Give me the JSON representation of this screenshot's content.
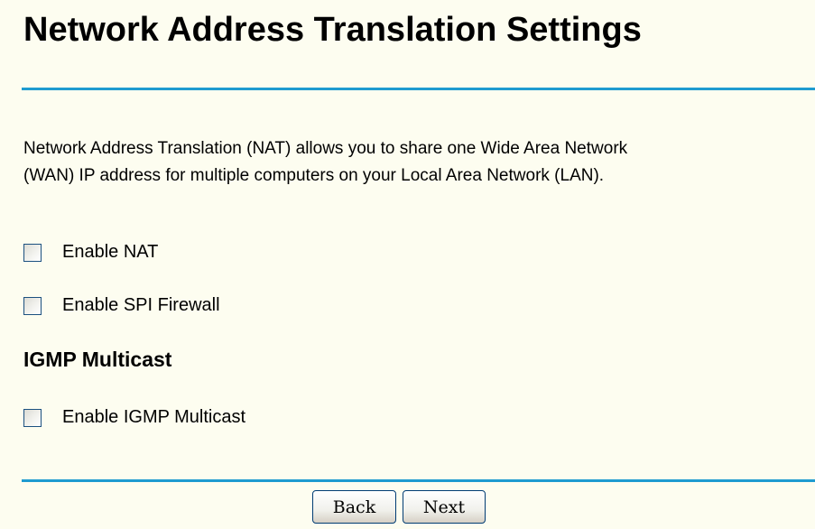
{
  "page": {
    "title": "Network Address Translation Settings",
    "description_line1": "Network Address Translation (NAT) allows you to share one Wide Area Network",
    "description_line2": "(WAN) IP address for multiple computers on your Local Area Network (LAN)."
  },
  "nat_options": [
    {
      "label": "Enable NAT",
      "checked": false
    },
    {
      "label": "Enable SPI Firewall",
      "checked": false
    }
  ],
  "igmp_section": {
    "heading": "IGMP Multicast",
    "option": {
      "label": "Enable IGMP Multicast",
      "checked": false
    }
  },
  "buttons": {
    "back_label": "Back",
    "next_label": "Next"
  },
  "colors": {
    "background": "#fdfdf0",
    "rule": "#1f9bd0",
    "checkbox_border": "#1c5180",
    "button_border": "#003c74"
  }
}
